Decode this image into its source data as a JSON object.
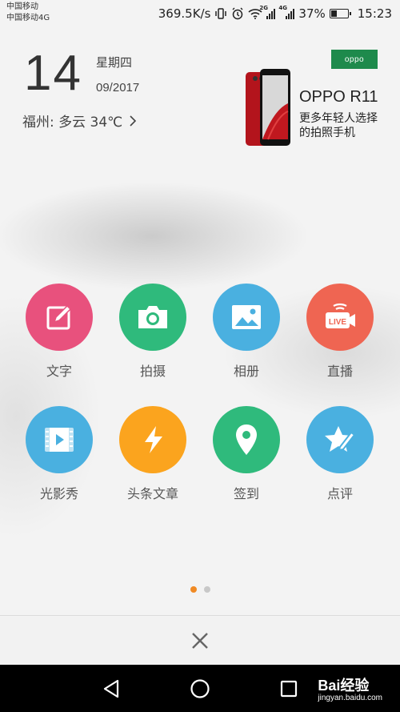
{
  "status_bar": {
    "carrier_1": "中国移动",
    "carrier_2": "中国移动4G",
    "speed": "369.5K/s",
    "sim1_tag": "2G",
    "sim2_tag": "4G",
    "battery_percent": "37%",
    "battery_level": 0.37,
    "time": "15:23"
  },
  "date_widget": {
    "day": "14",
    "weekday": "星期四",
    "month_year": "09/2017",
    "weather": "福州: 多云 34℃"
  },
  "ad": {
    "brand_logo": "oppo",
    "title": "OPPO R11",
    "subtitle": "更多年轻人选择的拍照手机"
  },
  "apps": [
    {
      "label": "文字",
      "icon": "edit-icon",
      "color": "#e8517d"
    },
    {
      "label": "拍摄",
      "icon": "camera-icon",
      "color": "#2fba7c"
    },
    {
      "label": "相册",
      "icon": "image-icon",
      "color": "#4ab0e0"
    },
    {
      "label": "直播",
      "icon": "live-icon",
      "color": "#ef6552"
    },
    {
      "label": "光影秀",
      "icon": "video-icon",
      "color": "#4ab0e0"
    },
    {
      "label": "头条文章",
      "icon": "lightning-icon",
      "color": "#fba41e"
    },
    {
      "label": "签到",
      "icon": "location-pin-icon",
      "color": "#2fba7c"
    },
    {
      "label": "点评",
      "icon": "star-pen-icon",
      "color": "#4ab0e0"
    }
  ],
  "pager": {
    "active_color": "#f08a24",
    "inactive_color": "#c8c8c8"
  },
  "watermark": {
    "brand": "Bai经验",
    "url": "jingyan.baidu.com"
  }
}
